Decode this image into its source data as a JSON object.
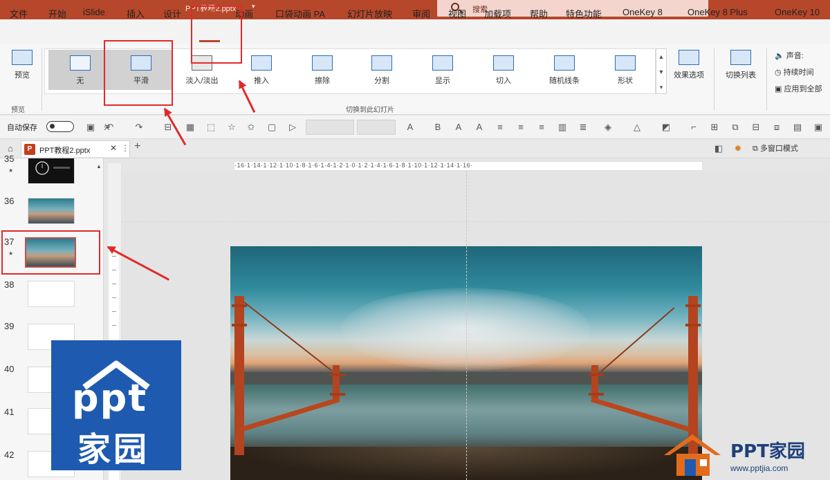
{
  "window": {
    "title": "PPT教程2.pptx",
    "search_placeholder": "搜索"
  },
  "menu": {
    "tabs": [
      "文件",
      "开始",
      "iSlide",
      "插入",
      "设计",
      "切换",
      "动画",
      "口袋动画 PA",
      "幻灯片放映",
      "审阅",
      "视图",
      "加载项",
      "帮助",
      "特色功能",
      "OneKey 8",
      "OneKey 8 Plus",
      "OneKey 10"
    ],
    "active": "切换"
  },
  "ribbon": {
    "preview_label": "预览",
    "preview_group_label": "预览",
    "transitions": [
      "无",
      "平滑",
      "淡入/淡出",
      "推入",
      "擦除",
      "分割",
      "显示",
      "切入",
      "随机线条",
      "形状"
    ],
    "selected_transition": "平滑",
    "effect_options_label": "效果选项",
    "transitions_group_label": "切换到此幻灯片",
    "switch_list_label": "切换列表",
    "sound_label": "声音:",
    "duration_label": "持续时间",
    "apply_all_label": "应用到全部"
  },
  "qat": {
    "autosave_label": "自动保存",
    "toggle_state": "关"
  },
  "doc": {
    "tab_name": "PPT教程2.pptx",
    "window_mode_label": "多窗口模式"
  },
  "slides": [
    {
      "number": "35",
      "type": "dark",
      "starred": true
    },
    {
      "number": "36",
      "type": "bridge",
      "starred": false
    },
    {
      "number": "37",
      "type": "bridge",
      "starred": true,
      "selected": true
    },
    {
      "number": "38",
      "type": "blank",
      "starred": false
    },
    {
      "number": "39",
      "type": "blank",
      "starred": false
    },
    {
      "number": "40",
      "type": "blank",
      "starred": false
    },
    {
      "number": "41",
      "type": "blank",
      "starred": false
    },
    {
      "number": "42",
      "type": "blank",
      "starred": false
    }
  ],
  "ruler": {
    "horizontal": "·16·1·14·1·12·1·10·1·8·1·6·1·4·1·2·1·0·1·2·1·4·1·6·1·8·1·10·1·12·1·14·1·16·"
  },
  "watermark": {
    "left_line1": "ppt",
    "left_line2": "家园",
    "right_title": "PPT家园",
    "right_url": "www.pptjia.com"
  },
  "colors": {
    "accent": "#b7472a",
    "annotation": "#e02a2a",
    "logo_blue": "#1e5bb0"
  }
}
